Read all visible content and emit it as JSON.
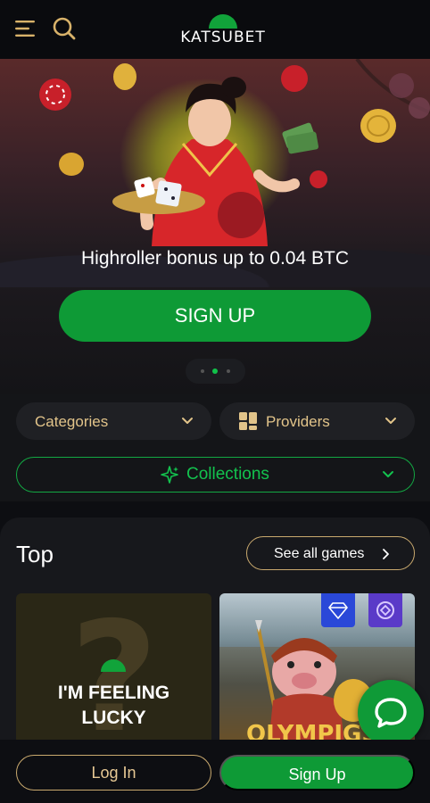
{
  "header": {
    "logo_text": "KATSUBET",
    "icons": [
      "menu-icon",
      "search-icon"
    ]
  },
  "hero": {
    "title": "Highroller bonus up to 0.04 BTC",
    "cta_label": "SIGN UP",
    "slide_count": 3,
    "active_slide": 2
  },
  "filters": {
    "categories_label": "Categories",
    "providers_label": "Providers",
    "collections_label": "Collections"
  },
  "top": {
    "title": "Top",
    "see_all_label": "See all games",
    "cards": [
      {
        "label_line1": "I'M FEELING",
        "label_line2": "LUCKY"
      },
      {
        "label": "OLYMPIGS"
      }
    ]
  },
  "bottom": {
    "login_label": "Log In",
    "signup_label": "Sign Up"
  },
  "colors": {
    "accent_green": "#0e9a36",
    "gold": "#c9a96e",
    "background": "#0d0e12"
  }
}
